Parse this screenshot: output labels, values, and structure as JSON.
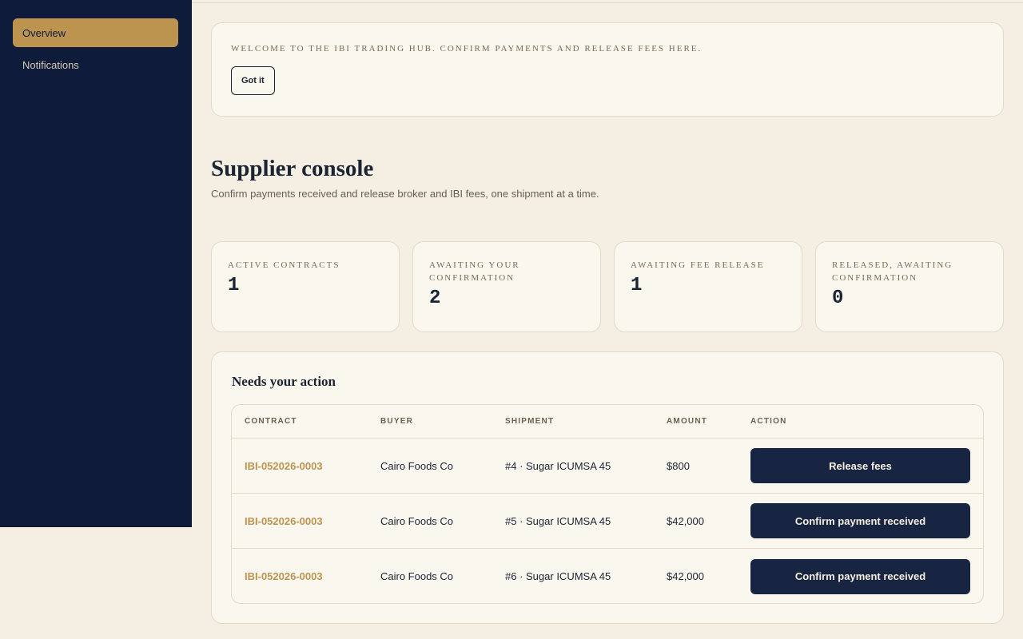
{
  "sidebar": {
    "items": [
      {
        "label": "Overview",
        "active": true
      },
      {
        "label": "Notifications",
        "active": false
      }
    ]
  },
  "welcome": {
    "text": "Welcome to the IBI trading hub. Confirm payments and release fees here.",
    "dismiss_label": "Got it"
  },
  "header": {
    "title": "Supplier console",
    "subtitle": "Confirm payments received and release broker and IBI fees, one shipment at a time."
  },
  "stats": [
    {
      "label": "Active contracts",
      "value": "1"
    },
    {
      "label": "Awaiting your confirmation",
      "value": "2"
    },
    {
      "label": "Awaiting fee release",
      "value": "1"
    },
    {
      "label": "Released, awaiting confirmation",
      "value": "0"
    }
  ],
  "actions": {
    "title": "Needs your action",
    "columns": [
      "Contract",
      "Buyer",
      "Shipment",
      "Amount",
      "Action"
    ],
    "rows": [
      {
        "contract": "IBI-052026-0003",
        "buyer": "Cairo Foods Co",
        "shipment": "#4 · Sugar ICUMSA 45",
        "amount": "$800",
        "action": "Release fees"
      },
      {
        "contract": "IBI-052026-0003",
        "buyer": "Cairo Foods Co",
        "shipment": "#5 · Sugar ICUMSA 45",
        "amount": "$42,000",
        "action": "Confirm payment received"
      },
      {
        "contract": "IBI-052026-0003",
        "buyer": "Cairo Foods Co",
        "shipment": "#6 · Sugar ICUMSA 45",
        "amount": "$42,000",
        "action": "Confirm payment received"
      }
    ]
  },
  "colors": {
    "sidebar_bg": "#0e1b3a",
    "accent_gold": "#bd944f",
    "button_navy": "#182542",
    "page_bg": "#f4eee3",
    "card_bg": "#faf7ef"
  }
}
